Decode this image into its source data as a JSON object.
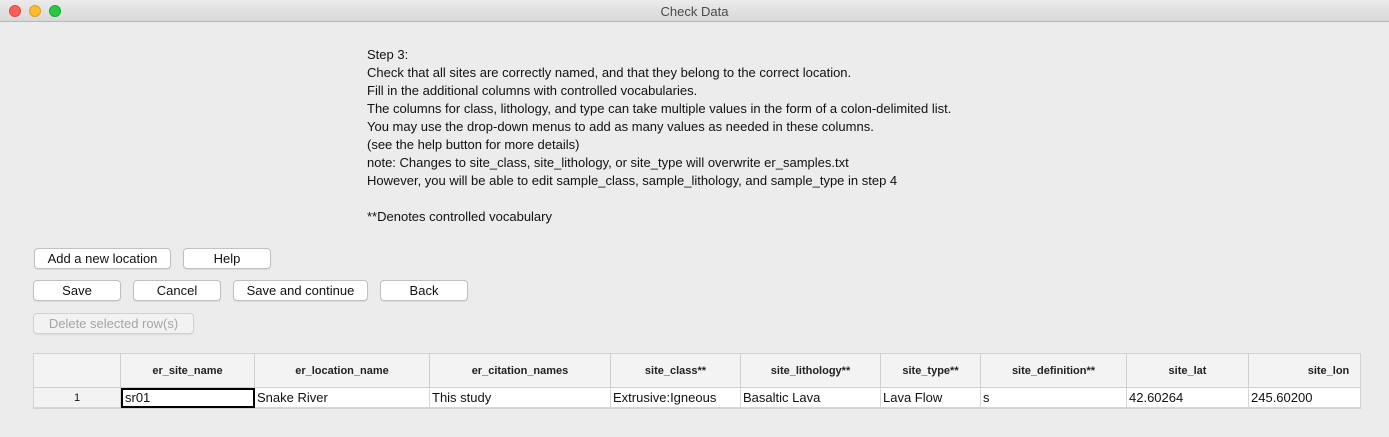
{
  "window": {
    "title": "Check Data"
  },
  "instructions": {
    "lines": [
      "Step 3:",
      "Check that all sites are correctly named, and that they belong to the correct location.",
      "Fill in the additional columns with controlled vocabularies.",
      "The columns for class, lithology, and type can take multiple values in the form of a colon-delimited list.",
      "You may use the drop-down menus to add as many values as needed in these columns.",
      "(see the help button for more details)",
      "note: Changes to site_class, site_lithology, or site_type will overwrite er_samples.txt",
      "However, you will be able to edit sample_class, sample_lithology, and sample_type in step 4"
    ],
    "vocab_note": "**Denotes controlled vocabulary"
  },
  "buttons": {
    "add_location": "Add a new location",
    "help": "Help",
    "save": "Save",
    "cancel": "Cancel",
    "save_continue": "Save and continue",
    "back": "Back",
    "delete_rows": "Delete selected row(s)"
  },
  "grid": {
    "columns": [
      "er_site_name",
      "er_location_name",
      "er_citation_names",
      "site_class**",
      "site_lithology**",
      "site_type**",
      "site_definition**",
      "site_lat",
      "site_lon"
    ],
    "rows": [
      {
        "label": "1",
        "cells": [
          "sr01",
          "Snake River",
          "This study",
          "Extrusive:Igneous",
          "Basaltic Lava",
          "Lava Flow",
          "s",
          "42.60264",
          "245.60200"
        ]
      }
    ]
  }
}
